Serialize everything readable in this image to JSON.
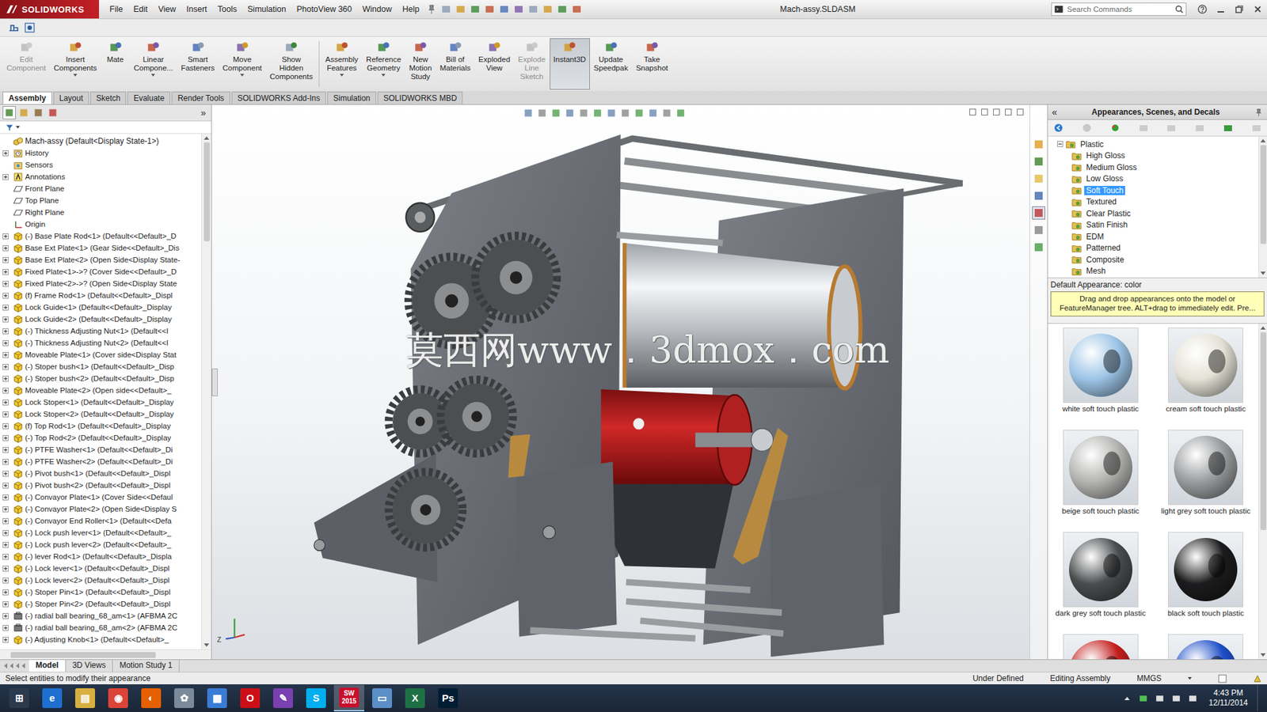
{
  "window": {
    "title": "Mach-assy.SLDASM",
    "logo": "SOLIDWORKS"
  },
  "menu": [
    "File",
    "Edit",
    "View",
    "Insert",
    "Tools",
    "Simulation",
    "PhotoView 360",
    "Window",
    "Help"
  ],
  "search": {
    "placeholder": "Search Commands"
  },
  "command_manager": [
    {
      "lines": [
        "Edit",
        "Component"
      ],
      "disabled": true,
      "selected": false,
      "dropdown": false,
      "separator_after": false
    },
    {
      "lines": [
        "Insert",
        "Components"
      ],
      "disabled": false,
      "selected": false,
      "dropdown": true,
      "separator_after": false
    },
    {
      "lines": [
        "Mate"
      ],
      "disabled": false,
      "selected": false,
      "dropdown": false,
      "separator_after": false
    },
    {
      "lines": [
        "Linear",
        "Compone..."
      ],
      "disabled": false,
      "selected": false,
      "dropdown": true,
      "separator_after": false
    },
    {
      "lines": [
        "Smart",
        "Fasteners"
      ],
      "disabled": false,
      "selected": false,
      "dropdown": false,
      "separator_after": false
    },
    {
      "lines": [
        "Move",
        "Component"
      ],
      "disabled": false,
      "selected": false,
      "dropdown": true,
      "separator_after": false
    },
    {
      "lines": [
        "Show",
        "Hidden",
        "Components"
      ],
      "disabled": false,
      "selected": false,
      "dropdown": false,
      "separator_after": true
    },
    {
      "lines": [
        "Assembly",
        "Features"
      ],
      "disabled": false,
      "selected": false,
      "dropdown": true,
      "separator_after": false
    },
    {
      "lines": [
        "Reference",
        "Geometry"
      ],
      "disabled": false,
      "selected": false,
      "dropdown": true,
      "separator_after": false
    },
    {
      "lines": [
        "New",
        "Motion",
        "Study"
      ],
      "disabled": false,
      "selected": false,
      "dropdown": false,
      "separator_after": false
    },
    {
      "lines": [
        "Bill of",
        "Materials"
      ],
      "disabled": false,
      "selected": false,
      "dropdown": false,
      "separator_after": false
    },
    {
      "lines": [
        "Exploded",
        "View"
      ],
      "disabled": false,
      "selected": false,
      "dropdown": false,
      "separator_after": false
    },
    {
      "lines": [
        "Explode",
        "Line",
        "Sketch"
      ],
      "disabled": true,
      "selected": false,
      "dropdown": false,
      "separator_after": false
    },
    {
      "lines": [
        "Instant3D"
      ],
      "disabled": false,
      "selected": true,
      "dropdown": false,
      "separator_after": false
    },
    {
      "lines": [
        "Update",
        "Speedpak"
      ],
      "disabled": false,
      "selected": false,
      "dropdown": false,
      "separator_after": false
    },
    {
      "lines": [
        "Take",
        "Snapshot"
      ],
      "disabled": false,
      "selected": false,
      "dropdown": false,
      "separator_after": false
    }
  ],
  "tabs": [
    {
      "label": "Assembly",
      "selected": true
    },
    {
      "label": "Layout",
      "selected": false
    },
    {
      "label": "Sketch",
      "selected": false
    },
    {
      "label": "Evaluate",
      "selected": false
    },
    {
      "label": "Render Tools",
      "selected": false
    },
    {
      "label": "SOLIDWORKS Add-Ins",
      "selected": false
    },
    {
      "label": "Simulation",
      "selected": false
    },
    {
      "label": "SOLIDWORKS MBD",
      "selected": false
    }
  ],
  "feature_tree": {
    "expand": "»",
    "items": [
      {
        "label": "Mach-assy  (Default<Display State-1>)",
        "kind": "assembly",
        "expandable": false
      },
      {
        "label": "History",
        "kind": "history",
        "expandable": true
      },
      {
        "label": "Sensors",
        "kind": "sensor",
        "expandable": false
      },
      {
        "label": "Annotations",
        "kind": "annotation",
        "expandable": true
      },
      {
        "label": "Front Plane",
        "kind": "plane",
        "expandable": false
      },
      {
        "label": "Top Plane",
        "kind": "plane",
        "expandable": false
      },
      {
        "label": "Right Plane",
        "kind": "plane",
        "expandable": false
      },
      {
        "label": "Origin",
        "kind": "origin",
        "expandable": false
      },
      {
        "label": "(-) Base Plate Rod<1> (Default<<Default>_D",
        "kind": "part",
        "expandable": true
      },
      {
        "label": "Base Ext Plate<1> (Gear Side<<Default>_Dis",
        "kind": "part",
        "expandable": true
      },
      {
        "label": "Base Ext Plate<2> (Open Side<Display State-",
        "kind": "part",
        "expandable": true
      },
      {
        "label": "Fixed Plate<1>->? (Cover Side<<Default>_D",
        "kind": "part",
        "expandable": true
      },
      {
        "label": "Fixed Plate<2>->? (Open Side<Display State",
        "kind": "part",
        "expandable": true
      },
      {
        "label": "(f) Frame Rod<1> (Default<<Default>_Displ",
        "kind": "part",
        "expandable": true
      },
      {
        "label": "Lock Guide<1> (Default<<Default>_Display",
        "kind": "part",
        "expandable": true
      },
      {
        "label": "Lock Guide<2> (Default<<Default>_Display",
        "kind": "part",
        "expandable": true
      },
      {
        "label": "(-) Thickness Adjusting Nut<1> (Default<<I",
        "kind": "part",
        "expandable": true
      },
      {
        "label": "(-) Thickness Adjusting Nut<2> (Default<<I",
        "kind": "part",
        "expandable": true
      },
      {
        "label": "Moveable Plate<1> (Cover side<Display Stat",
        "kind": "part",
        "expandable": true
      },
      {
        "label": "(-) Stoper bush<1> (Default<<Default>_Disp",
        "kind": "part",
        "expandable": true
      },
      {
        "label": "(-) Stoper bush<2> (Default<<Default>_Disp",
        "kind": "part",
        "expandable": true
      },
      {
        "label": "Moveable Plate<2> (Open side<<Default>_",
        "kind": "part",
        "expandable": true
      },
      {
        "label": "Lock Stoper<1> (Default<<Default>_Display",
        "kind": "part",
        "expandable": true
      },
      {
        "label": "Lock Stoper<2> (Default<<Default>_Display",
        "kind": "part",
        "expandable": true
      },
      {
        "label": "(f) Top Rod<1> (Default<<Default>_Display",
        "kind": "part",
        "expandable": true
      },
      {
        "label": "(-) Top Rod<2> (Default<<Default>_Display",
        "kind": "part",
        "expandable": true
      },
      {
        "label": "(-) PTFE Washer<1> (Default<<Default>_Di",
        "kind": "part",
        "expandable": true
      },
      {
        "label": "(-) PTFE Washer<2> (Default<<Default>_Di",
        "kind": "part",
        "expandable": true
      },
      {
        "label": "(-) Pivot bush<1> (Default<<Default>_Displ",
        "kind": "part",
        "expandable": true
      },
      {
        "label": "(-) Pivot bush<2> (Default<<Default>_Displ",
        "kind": "part",
        "expandable": true
      },
      {
        "label": "(-) Convayor Plate<1> (Cover Side<<Defaul",
        "kind": "part",
        "expandable": true
      },
      {
        "label": "(-) Convayor Plate<2> (Open Side<Display S",
        "kind": "part",
        "expandable": true
      },
      {
        "label": "(-) Convayor End Roller<1> (Default<<Defa",
        "kind": "part",
        "expandable": true
      },
      {
        "label": "(-) Lock push lever<1> (Default<<Default>_",
        "kind": "part",
        "expandable": true
      },
      {
        "label": "(-) Lock push lever<2> (Default<<Default>_",
        "kind": "part",
        "expandable": true
      },
      {
        "label": "(-) lever Rod<1> (Default<<Default>_Displa",
        "kind": "part",
        "expandable": true
      },
      {
        "label": "(-) Lock lever<1> (Default<<Default>_Displ",
        "kind": "part",
        "expandable": true
      },
      {
        "label": "(-) Lock lever<2> (Default<<Default>_Displ",
        "kind": "part",
        "expandable": true
      },
      {
        "label": "(-) Stoper Pin<1> (Default<<Default>_Displ",
        "kind": "part",
        "expandable": true
      },
      {
        "label": "(-) Stoper Pin<2> (Default<<Default>_Displ",
        "kind": "part",
        "expandable": true
      },
      {
        "label": "(-) radial ball bearing_68_am<1> (AFBMA 2C",
        "kind": "toolbox",
        "expandable": true
      },
      {
        "label": "(-) radial ball bearing_68_am<2> (AFBMA 2C",
        "kind": "toolbox",
        "expandable": true
      },
      {
        "label": "(-) Adjusting Knob<1> (Default<<Default>_",
        "kind": "part",
        "expandable": true
      }
    ]
  },
  "viewport": {
    "watermark": "莫西网www．3dmox．com",
    "triad_label": "Z"
  },
  "task_pane": {
    "title": "Appearances, Scenes, and Decals",
    "collapse": "«",
    "tree": [
      {
        "label": "Plastic",
        "level": 0,
        "expandable": true,
        "expanded": true,
        "selected": false
      },
      {
        "label": "High Gloss",
        "level": 1,
        "expandable": false,
        "expanded": false,
        "selected": false
      },
      {
        "label": "Medium Gloss",
        "level": 1,
        "expandable": false,
        "expanded": false,
        "selected": false
      },
      {
        "label": "Low Gloss",
        "level": 1,
        "expandable": false,
        "expanded": false,
        "selected": false
      },
      {
        "label": "Soft Touch",
        "level": 1,
        "expandable": false,
        "expanded": false,
        "selected": true
      },
      {
        "label": "Textured",
        "level": 1,
        "expandable": false,
        "expanded": false,
        "selected": false
      },
      {
        "label": "Clear Plastic",
        "level": 1,
        "expandable": false,
        "expanded": false,
        "selected": false
      },
      {
        "label": "Satin Finish",
        "level": 1,
        "expandable": false,
        "expanded": false,
        "selected": false
      },
      {
        "label": "EDM",
        "level": 1,
        "expandable": false,
        "expanded": false,
        "selected": false
      },
      {
        "label": "Patterned",
        "level": 1,
        "expandable": false,
        "expanded": false,
        "selected": false
      },
      {
        "label": "Composite",
        "level": 1,
        "expandable": false,
        "expanded": false,
        "selected": false
      },
      {
        "label": "Mesh",
        "level": 1,
        "expandable": false,
        "expanded": false,
        "selected": false
      }
    ],
    "default_appearance": "Default Appearance: color",
    "tooltip": "Drag and drop appearances onto the model or FeatureManager tree.  ALT+drag to immediately edit.  Pre...",
    "swatches": [
      {
        "label": "white soft touch plastic",
        "color": "#9cc4e6"
      },
      {
        "label": "cream soft touch plastic",
        "color": "#e4e2d6"
      },
      {
        "label": "beige soft touch plastic",
        "color": "#b4b4b2"
      },
      {
        "label": "light grey soft touch plastic",
        "color": "#9a9c9e"
      },
      {
        "label": "dark grey soft touch plastic",
        "color": "#4a4c4e"
      },
      {
        "label": "black soft touch plastic",
        "color": "#1c1c1e"
      },
      {
        "label": "",
        "color": "#c41e1e"
      },
      {
        "label": "",
        "color": "#1e4fc8"
      }
    ]
  },
  "bottom_tabs": [
    {
      "label": "Model",
      "selected": true
    },
    {
      "label": "3D Views",
      "selected": false
    },
    {
      "label": "Motion Study 1",
      "selected": false
    }
  ],
  "status_bar": {
    "message": "Select entities to modify their appearance",
    "items": [
      "Under Defined",
      "Editing Assembly",
      "MMGS"
    ]
  },
  "taskbar": {
    "time": "4:43 PM",
    "date": "12/11/2014",
    "apps": [
      {
        "glyph": "⊞",
        "color": "#2b3a4d",
        "active": false
      },
      {
        "glyph": "e",
        "color": "#1e6fd0",
        "active": false
      },
      {
        "glyph": "▤",
        "color": "#d8b040",
        "active": false
      },
      {
        "glyph": "◉",
        "color": "#db4437",
        "active": false
      },
      {
        "glyph": "◐",
        "color": "#e66000",
        "active": false
      },
      {
        "glyph": "✿",
        "color": "#7a8a9a",
        "active": false
      },
      {
        "glyph": "▦",
        "color": "#3a7bd5",
        "active": false
      },
      {
        "glyph": "O",
        "color": "#cc0f16",
        "active": false
      },
      {
        "glyph": "✎",
        "color": "#7a3fb0",
        "active": false
      },
      {
        "glyph": "S",
        "color": "#00aff0",
        "active": false
      },
      {
        "glyph": "SW\n2015",
        "color": "#c8102e",
        "active": true
      },
      {
        "glyph": "▭",
        "color": "#5a8fc8",
        "active": false
      },
      {
        "glyph": "X",
        "color": "#1d7044",
        "active": false
      },
      {
        "glyph": "Ps",
        "color": "#001d34",
        "active": false
      }
    ]
  }
}
